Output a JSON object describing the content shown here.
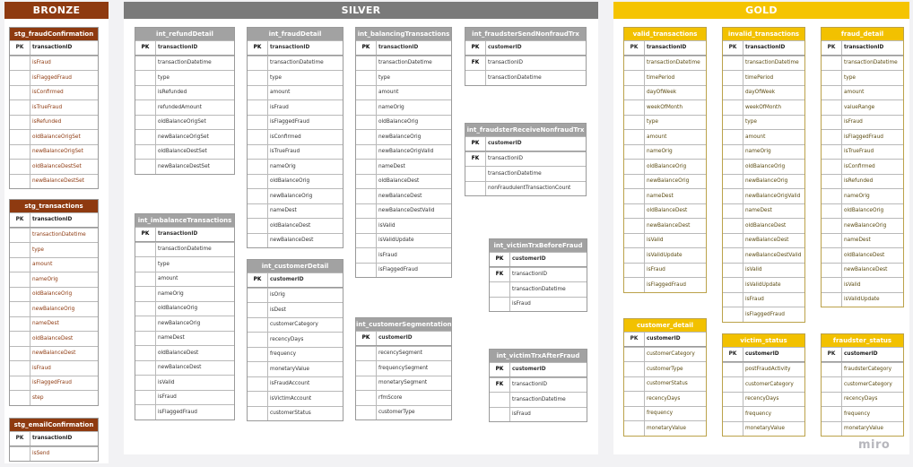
{
  "zones": [
    {
      "id": "bronze",
      "title": "BRONZE",
      "color": "#8e3a10"
    },
    {
      "id": "silver",
      "title": "SILVER",
      "color": "#7a7a7a"
    },
    {
      "id": "gold",
      "title": "GOLD",
      "color": "#f5c400"
    }
  ],
  "tables": [
    {
      "layer": "bronze",
      "name": "stg_fraudConfirmation",
      "pk": "transactionID",
      "fk": [],
      "columns": [
        "isFraud",
        "isFlaggedFraud",
        "isConfirmed",
        "isTrueFraud",
        "isRefunded",
        "oldBalanceOrigSet",
        "newBalanceOrigSet",
        "oldBalanceDestSet",
        "newBalanceDestSet"
      ]
    },
    {
      "layer": "bronze",
      "name": "stg_transactions",
      "pk": "transactionID",
      "fk": [],
      "columns": [
        "transactionDatetime",
        "type",
        "amount",
        "nameOrig",
        "oldBalanceOrig",
        "newBalanceOrig",
        "nameDest",
        "oldBalanceDest",
        "newBalanceDest",
        "isFraud",
        "isFlaggedFraud",
        "step"
      ]
    },
    {
      "layer": "bronze",
      "name": "stg_emailConfirmation",
      "pk": "transactionID",
      "fk": [],
      "columns": [
        "isSend"
      ]
    },
    {
      "layer": "silver",
      "name": "int_refundDetail",
      "pk": "transactionID",
      "fk": [],
      "columns": [
        "transactionDatetime",
        "type",
        "isRefunded",
        "refundedAmount",
        "oldBalanceOrigSet",
        "newBalanceOrigSet",
        "oldBalanceDestSet",
        "newBalanceDestSet"
      ]
    },
    {
      "layer": "silver",
      "name": "int_imbalanceTransactions",
      "pk": "transactionID",
      "fk": [],
      "columns": [
        "transactionDatetime",
        "type",
        "amount",
        "nameOrig",
        "oldBalanceOrig",
        "newBalanceOrig",
        "nameDest",
        "oldBalanceDest",
        "newBalanceDest",
        "isValid",
        "isFraud",
        "isFlaggedFraud"
      ]
    },
    {
      "layer": "silver",
      "name": "int_fraudDetail",
      "pk": "transactionID",
      "fk": [],
      "columns": [
        "transactionDatetime",
        "type",
        "amount",
        "isFraud",
        "isFlaggedFraud",
        "isConfirmed",
        "isTrueFraud",
        "nameOrig",
        "oldBalanceOrig",
        "newBalanceOrig",
        "nameDest",
        "oldBalanceDest",
        "newBalanceDest"
      ]
    },
    {
      "layer": "silver",
      "name": "int_customerDetail",
      "pk": "customerID",
      "fk": [],
      "columns": [
        "isOrig",
        "isDest",
        "customerCategory",
        "recencyDays",
        "frequency",
        "monetaryValue",
        "isFraudAccount",
        "isVictimAccount",
        "customerStatus"
      ]
    },
    {
      "layer": "silver",
      "name": "int_balancingTransactions",
      "pk": "transactionID",
      "fk": [],
      "columns": [
        "transactionDatetime",
        "type",
        "amount",
        "nameOrig",
        "oldBalanceOrig",
        "newBalanceOrig",
        "newBalanceOrigValid",
        "nameDest",
        "oldBalanceDest",
        "newBalanceDest",
        "newBalanceDestValid",
        "isValid",
        "isValidUpdate",
        "isFraud",
        "isFlaggedFraud"
      ]
    },
    {
      "layer": "silver",
      "name": "int_customerSegmentation",
      "pk": "customerID",
      "fk": [],
      "columns": [
        "recencySegment",
        "frequencySegment",
        "monetarySegment",
        "rfmScore",
        "customerType"
      ]
    },
    {
      "layer": "silver",
      "name": "int_fraudsterSendNonfraudTrx",
      "pk": "customerID",
      "fk": [
        "transactionID"
      ],
      "columns": [
        "transactionDatetime"
      ]
    },
    {
      "layer": "silver",
      "name": "int_fraudsterReceiveNonfraudTrx",
      "pk": "customerID",
      "fk": [
        "transactionID"
      ],
      "columns": [
        "transactionDatetime",
        "nonFraudulentTransactionCount"
      ]
    },
    {
      "layer": "silver",
      "name": "int_victimTrxBeforeFraud",
      "pk": "customerID",
      "fk": [
        "transactionID"
      ],
      "columns": [
        "transactionDatetime",
        "isFraud"
      ]
    },
    {
      "layer": "silver",
      "name": "int_victimTrxAfterFraud",
      "pk": "customerID",
      "fk": [
        "transactionID"
      ],
      "columns": [
        "transactionDatetime",
        "isFraud"
      ]
    },
    {
      "layer": "gold",
      "name": "valid_transactions",
      "pk": "transactionID",
      "fk": [],
      "columns": [
        "transactionDatetime",
        "timePeriod",
        "dayOfWeek",
        "weekOfMonth",
        "type",
        "amount",
        "nameOrig",
        "oldBalanceOrig",
        "newBalanceOrig",
        "nameDest",
        "oldBalanceDest",
        "newBalanceDest",
        "isValid",
        "isValidUpdate",
        "isFraud",
        "isFlaggedFraud"
      ]
    },
    {
      "layer": "gold",
      "name": "invalid_transactions",
      "pk": "transactionID",
      "fk": [],
      "columns": [
        "transactionDatetime",
        "timePeriod",
        "dayOfWeek",
        "weekOfMonth",
        "type",
        "amount",
        "nameOrig",
        "oldBalanceOrig",
        "newBalanceOrig",
        "newBalanceOrigValid",
        "nameDest",
        "oldBalanceDest",
        "newBalanceDest",
        "newBalanceDestValid",
        "isValid",
        "isValidUpdate",
        "isFraud",
        "isFlaggedFraud"
      ]
    },
    {
      "layer": "gold",
      "name": "fraud_detail",
      "pk": "transactionID",
      "fk": [],
      "columns": [
        "transactionDatetime",
        "type",
        "amount",
        "valueRange",
        "isFraud",
        "isFlaggedFraud",
        "isTrueFraud",
        "isConfirmed",
        "isRefunded",
        "nameOrig",
        "oldBalanceOrig",
        "newBalanceOrig",
        "nameDest",
        "oldBalanceDest",
        "newBalanceDest",
        "isValid",
        "isValidUpdate"
      ]
    },
    {
      "layer": "gold",
      "name": "customer_detail",
      "pk": "customerID",
      "fk": [],
      "columns": [
        "customerCategory",
        "customerType",
        "customerStatus",
        "recencyDays",
        "frequency",
        "monetaryValue"
      ]
    },
    {
      "layer": "gold",
      "name": "victim_status",
      "pk": "customerID",
      "fk": [],
      "columns": [
        "postFraudActivity",
        "customerCategory",
        "recencyDays",
        "frequency",
        "monetaryValue"
      ]
    },
    {
      "layer": "gold",
      "name": "fraudster_status",
      "pk": "customerID",
      "fk": [],
      "columns": [
        "fraudsterCategory",
        "customerCategory",
        "recencyDays",
        "frequency",
        "monetaryValue"
      ]
    }
  ],
  "key_labels": {
    "pk": "PK",
    "fk": "FK"
  },
  "watermark": "miro"
}
